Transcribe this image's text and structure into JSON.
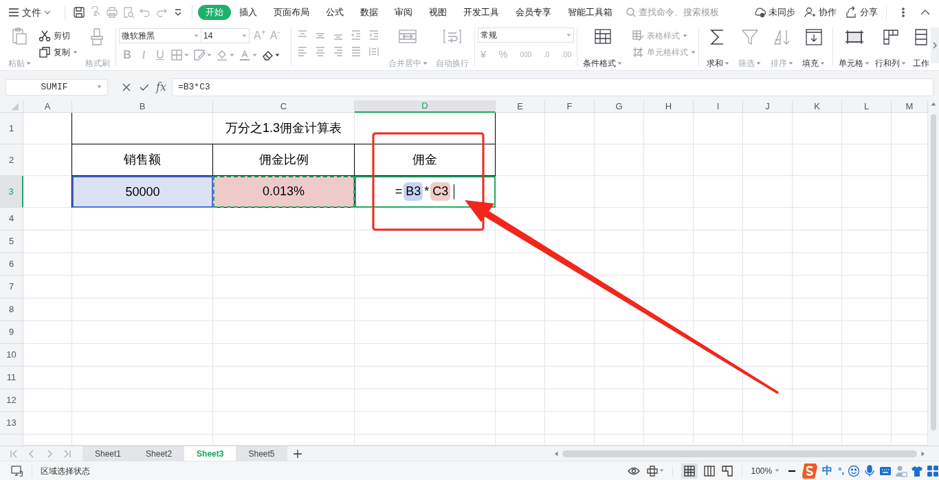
{
  "menu": {
    "label": "文件"
  },
  "tabs": [
    {
      "label": "开始",
      "selected": true
    },
    {
      "label": "插入",
      "selected": false
    },
    {
      "label": "页面布局",
      "selected": false
    },
    {
      "label": "公式",
      "selected": false
    },
    {
      "label": "数据",
      "selected": false
    },
    {
      "label": "审阅",
      "selected": false
    },
    {
      "label": "视图",
      "selected": false
    },
    {
      "label": "开发工具",
      "selected": false
    },
    {
      "label": "会员专享",
      "selected": false
    },
    {
      "label": "智能工具箱",
      "selected": false
    }
  ],
  "search": {
    "placeholder": "查找命令、搜索模板"
  },
  "actions": [
    "未同步",
    "协作",
    "分享"
  ],
  "ribbon": {
    "clipboard": [
      {
        "label": "粘贴",
        "disabled": true,
        "dropdown": true
      },
      {
        "label": "剪切",
        "disabled": false,
        "dropdown": false
      },
      {
        "label": "复制",
        "disabled": false,
        "dropdown": true
      },
      {
        "label": "格式刷",
        "disabled": true,
        "dropdown": false
      }
    ],
    "font": {
      "font_name": "微软雅黑",
      "font_size": "14",
      "size_buttons": [
        "A$^{+}$",
        "A$^{-}$"
      ],
      "style_buttons": [
        "B",
        "I",
        "U"
      ]
    },
    "alignment": [
      {
        "label": "合并居中",
        "disabled": true,
        "dropdown": true
      },
      {
        "label": "自动换行",
        "disabled": true,
        "dropdown": false
      }
    ],
    "number": {
      "format": "常规",
      "buttons": [
        "¥",
        "%",
        "000",
        ".0",
        ".00"
      ]
    },
    "styles": [
      {
        "label": "条件格式",
        "disabled": false,
        "dropdown": true
      },
      {
        "label": "表格样式",
        "disabled": true,
        "dropdown": true
      },
      {
        "label": "单元格样式",
        "disabled": true,
        "dropdown": true
      }
    ],
    "editing": [
      {
        "label": "求和",
        "disabled": false,
        "dropdown": true
      },
      {
        "label": "筛选",
        "disabled": true,
        "dropdown": true
      },
      {
        "label": "排序",
        "disabled": true,
        "dropdown": true
      },
      {
        "label": "填充",
        "disabled": false,
        "dropdown": true
      }
    ],
    "cells": [
      {
        "label": "单元格",
        "disabled": false,
        "dropdown": true
      },
      {
        "label": "行和列",
        "disabled": false,
        "dropdown": true
      },
      {
        "label": "工作",
        "disabled": false,
        "dropdown": false
      }
    ]
  },
  "formula_bar": {
    "name_box": "SUMIF",
    "function_label": "fx",
    "formula": "=B3*C3"
  },
  "columns": [
    {
      "label": "A",
      "selected": false
    },
    {
      "label": "B",
      "selected": false
    },
    {
      "label": "C",
      "selected": false
    },
    {
      "label": "D",
      "selected": true
    },
    {
      "label": "E",
      "selected": false
    },
    {
      "label": "F",
      "selected": false
    },
    {
      "label": "G",
      "selected": false
    },
    {
      "label": "H",
      "selected": false
    },
    {
      "label": "I",
      "selected": false
    },
    {
      "label": "J",
      "selected": false
    },
    {
      "label": "K",
      "selected": false
    },
    {
      "label": "L",
      "selected": false
    },
    {
      "label": "M",
      "selected": false
    }
  ],
  "rows": [
    {
      "label": "1",
      "selected": false
    },
    {
      "label": "2",
      "selected": false
    },
    {
      "label": "3",
      "selected": true
    },
    {
      "label": "4",
      "selected": false
    },
    {
      "label": "5",
      "selected": false
    },
    {
      "label": "6",
      "selected": false
    },
    {
      "label": "7",
      "selected": false
    },
    {
      "label": "8",
      "selected": false
    },
    {
      "label": "9",
      "selected": false
    },
    {
      "label": "10",
      "selected": false
    },
    {
      "label": "11",
      "selected": false
    },
    {
      "label": "12",
      "selected": false
    },
    {
      "label": "13",
      "selected": false
    }
  ],
  "table": {
    "title": "万分之1.3佣金计算表",
    "headers": [
      "销售额",
      "佣金比例",
      "佣金"
    ],
    "values": [
      {
        "kind": "value",
        "text": "50000",
        "color": "#dbe2f4",
        "selected": true,
        "copied": false
      },
      {
        "kind": "value",
        "text": "0.013%",
        "color": "#efcaca",
        "selected": false,
        "copied": true
      },
      {
        "kind": "formula",
        "parts": [
          {
            "kind": "operator",
            "text": "="
          },
          {
            "kind": "reference",
            "text": "B3",
            "color": "#c7d4f1"
          },
          {
            "kind": "operator",
            "text": "*"
          },
          {
            "kind": "reference",
            "text": "C3",
            "color": "#efcdc6"
          }
        ]
      }
    ]
  },
  "sheets": [
    {
      "label": "Sheet1",
      "selected": false
    },
    {
      "label": "Sheet2",
      "selected": false
    },
    {
      "label": "Sheet3",
      "selected": true
    },
    {
      "label": "Sheet5",
      "selected": false
    }
  ],
  "status_bar": {
    "text": "区域选择状态",
    "zoom": "100%",
    "ime": [
      "中",
      "°,"
    ]
  }
}
